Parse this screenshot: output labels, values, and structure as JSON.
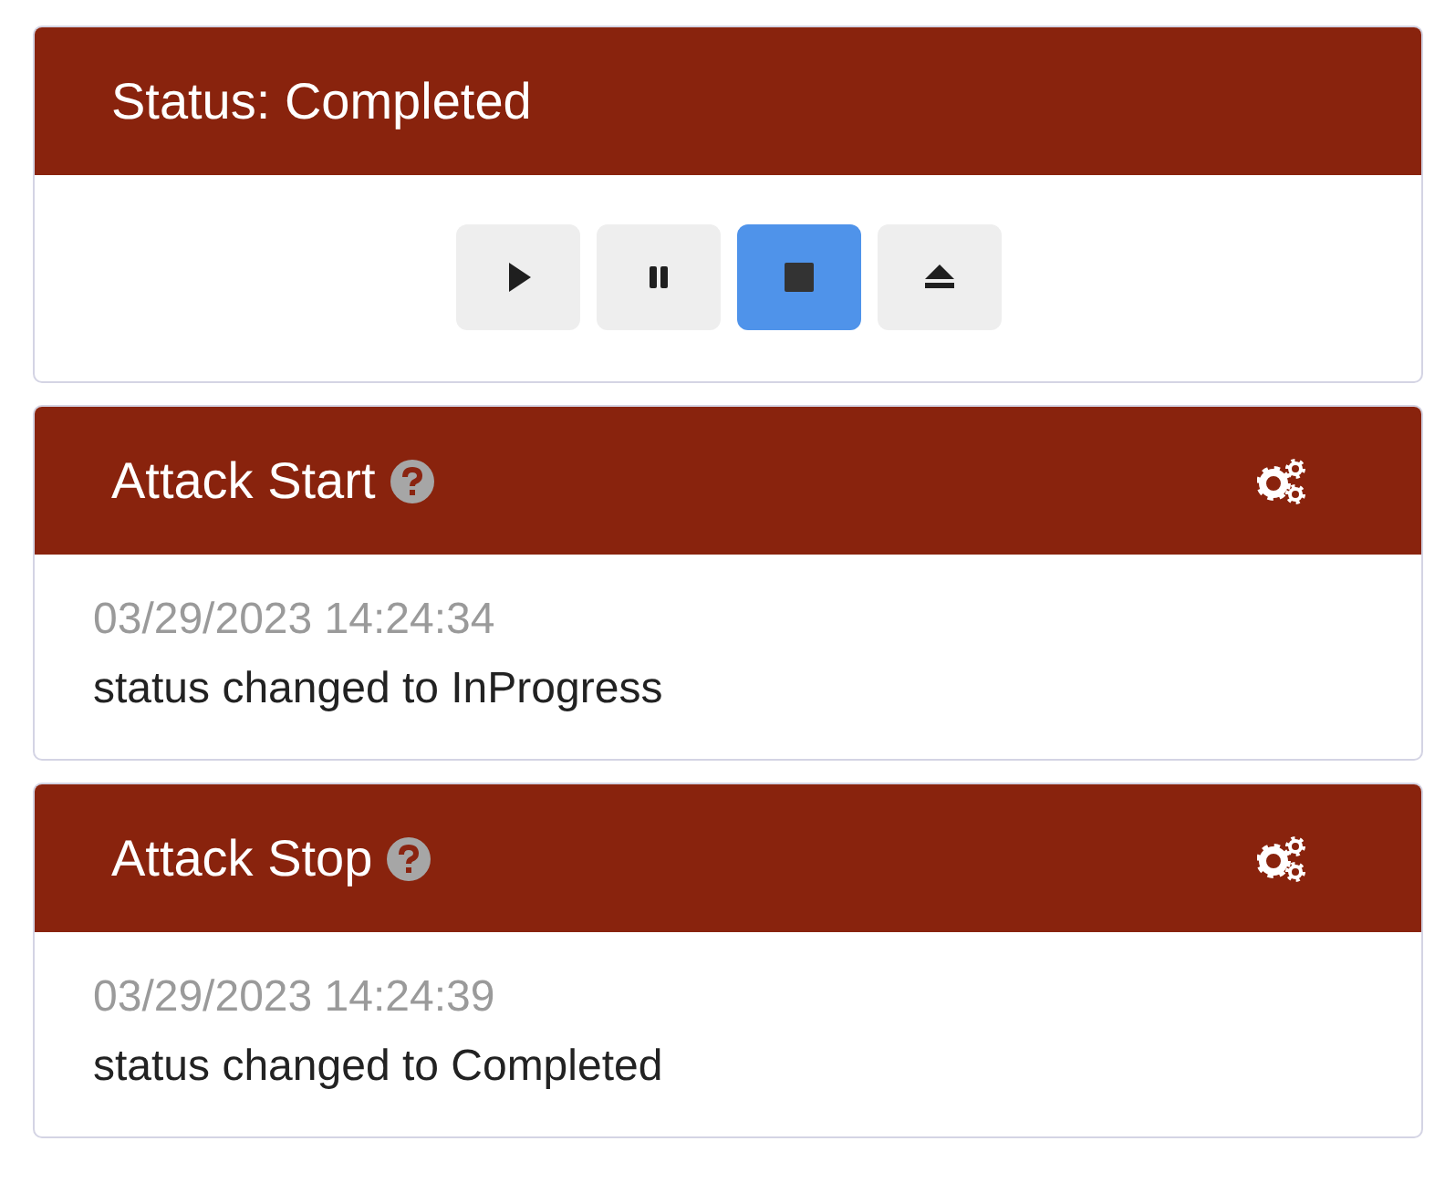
{
  "status_panel": {
    "title": "Status: Completed",
    "buttons": [
      {
        "kind": "play",
        "selected": false
      },
      {
        "kind": "pause",
        "selected": false
      },
      {
        "kind": "stop",
        "selected": true
      },
      {
        "kind": "eject",
        "selected": false
      }
    ]
  },
  "events": [
    {
      "title": "Attack Start",
      "timestamp": "03/29/2023 14:24:34",
      "message": "status changed to InProgress"
    },
    {
      "title": "Attack Stop",
      "timestamp": "03/29/2023 14:24:39",
      "message": "status changed to Completed"
    }
  ]
}
